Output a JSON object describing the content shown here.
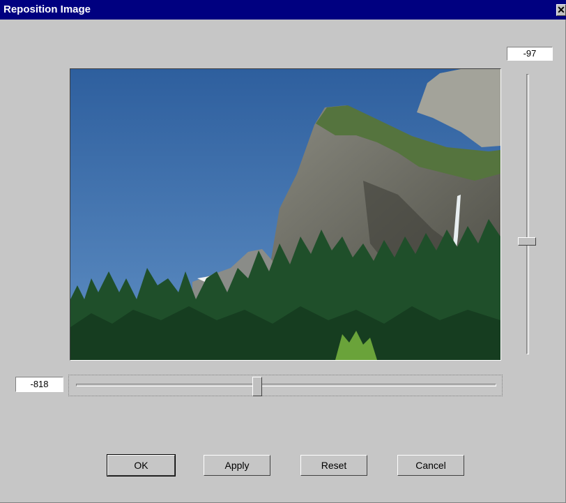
{
  "window": {
    "title": "Reposition Image",
    "close_glyph": "✕"
  },
  "vertical_offset": {
    "value": "-97",
    "slider_level": 0.6
  },
  "horizontal_offset": {
    "value": "-818",
    "slider_level": 0.43
  },
  "preview": {
    "subject": "mountain cliff with waterfall and forest"
  },
  "buttons": {
    "ok": "OK",
    "apply": "Apply",
    "reset": "Reset",
    "cancel": "Cancel"
  },
  "colors": {
    "titlebar": "#000080",
    "dialog_bg": "#c6c6c6",
    "sky": "#3a6da8"
  }
}
